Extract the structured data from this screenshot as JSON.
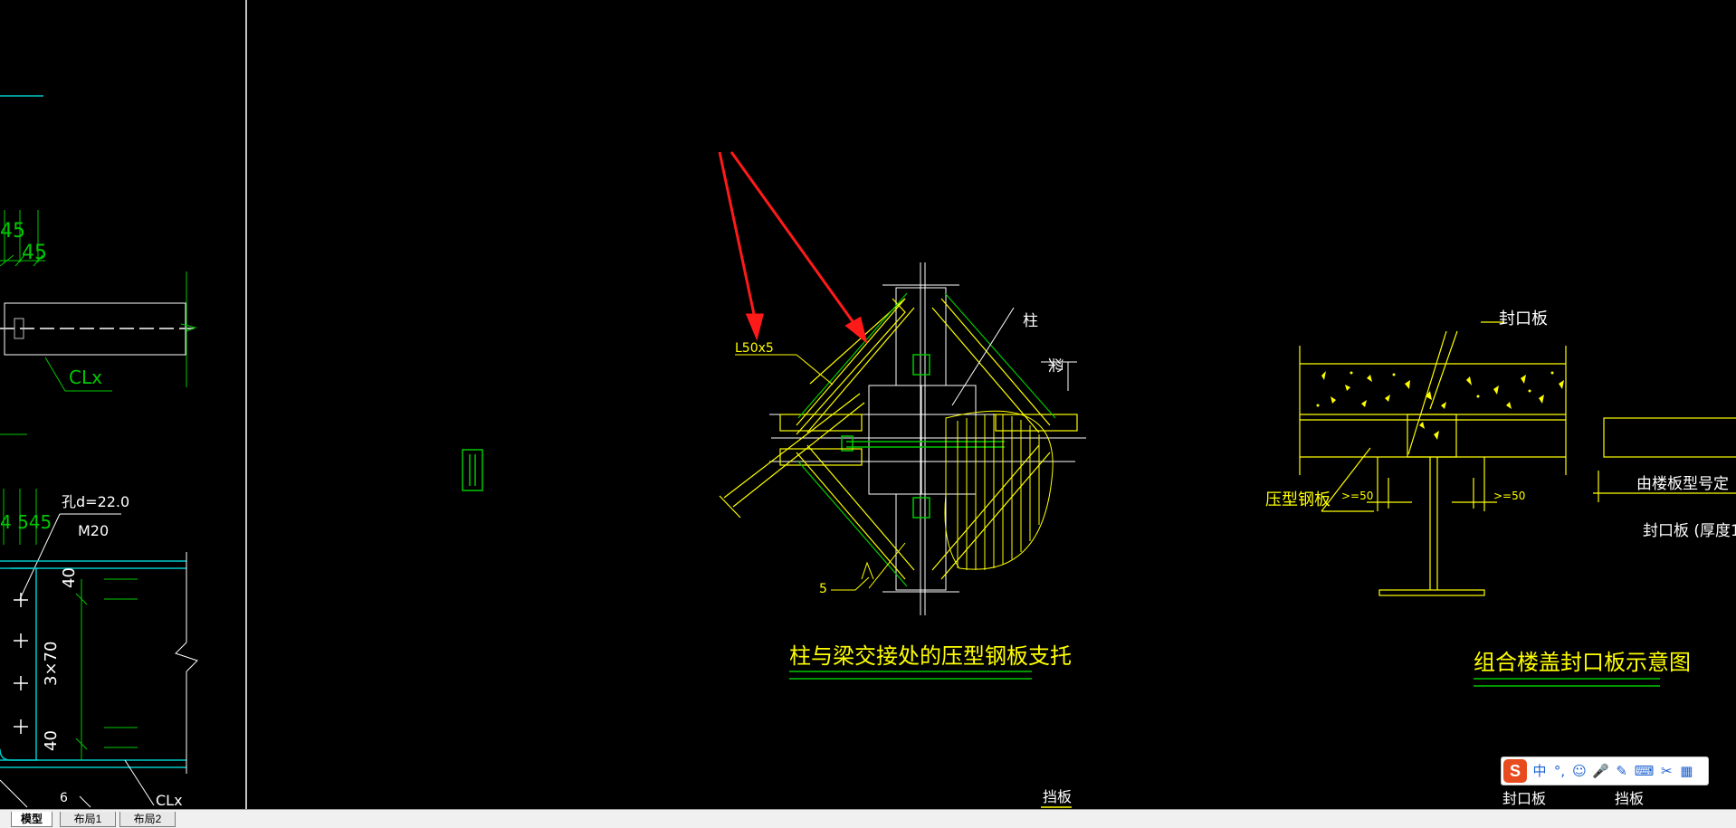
{
  "drawing": {
    "left_panel": {
      "dim_45_a": "45",
      "dim_45_b": "45",
      "dim_4_545": "4 545",
      "label_clx_top": "CLx",
      "label_clx_bottom": "CLx",
      "hole_note": "孔d=22.0",
      "bolt_note": "M20",
      "dim_40_top": "40",
      "dim_3x70": "3×70",
      "dim_40_bottom": "40",
      "dim_6": "6"
    },
    "detail_1": {
      "angle_label": "L50x5",
      "column_label": "柱",
      "beam_label": "梁",
      "weld_size": "5",
      "title": "柱与梁交接处的压型钢板支托"
    },
    "detail_2": {
      "seal_plate_label": "封口板",
      "deck_label": "压型钢板",
      "dim_ge50_left": ">=50",
      "dim_ge50_right": ">=50",
      "note_deck_type": "由楼板型号定",
      "note_thickness": "封口板  (厚度1.",
      "title": "组合楼盖封口板示意图"
    },
    "bottom_labels": {
      "dangban_center": "挡板",
      "fengkouban": "封口板",
      "dangban_right": "挡板"
    }
  },
  "tabs": [
    {
      "label": "模型",
      "active": true
    },
    {
      "label": "布局1",
      "active": false
    },
    {
      "label": "布局2",
      "active": false
    }
  ],
  "ime_toolbar": {
    "logo": "S",
    "mode": "中",
    "punct": "°,",
    "emoji": "☺",
    "voice": "🎤",
    "pen": "✎",
    "keyboard": "⌨",
    "scissors": "✂",
    "grid": "▦"
  },
  "colors": {
    "background": "#000000",
    "yellow": "#ffff00",
    "green": "#00c800",
    "white": "#ffffff",
    "cyan": "#00c8c8",
    "red_arrow": "#ff1a1a"
  }
}
